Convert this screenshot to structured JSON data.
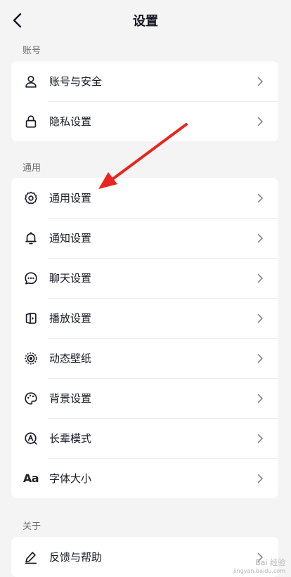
{
  "header": {
    "title": "设置"
  },
  "sections": [
    {
      "label": "账号",
      "items": [
        {
          "label": "账号与安全",
          "icon": "user-icon"
        },
        {
          "label": "隐私设置",
          "icon": "lock-icon"
        }
      ]
    },
    {
      "label": "通用",
      "items": [
        {
          "label": "通用设置",
          "icon": "gear-icon"
        },
        {
          "label": "通知设置",
          "icon": "bell-icon"
        },
        {
          "label": "聊天设置",
          "icon": "chat-bubble-icon"
        },
        {
          "label": "播放设置",
          "icon": "play-screen-icon"
        },
        {
          "label": "动态壁纸",
          "icon": "live-wallpaper-icon"
        },
        {
          "label": "背景设置",
          "icon": "palette-icon"
        },
        {
          "label": "长辈模式",
          "icon": "elder-mode-icon"
        },
        {
          "label": "字体大小",
          "icon": "font-size-icon",
          "icon_text": "Aa"
        }
      ]
    },
    {
      "label": "关于",
      "items": [
        {
          "label": "反馈与帮助",
          "icon": "pencil-icon"
        }
      ]
    }
  ],
  "annotation": {
    "arrow_color": "#e8261f"
  },
  "watermark": {
    "line1": "Bai 经验",
    "line2": "jingyan.baidu.com"
  }
}
